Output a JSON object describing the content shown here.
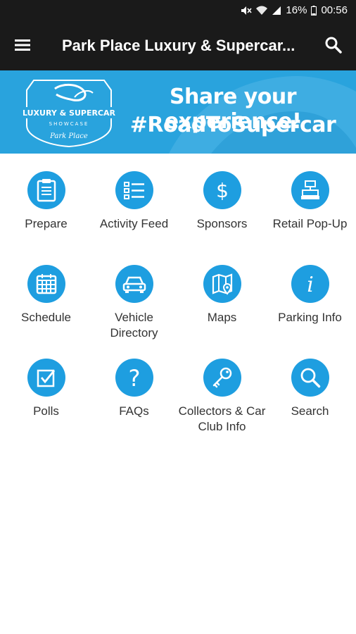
{
  "status_bar": {
    "battery": "16%",
    "time": "00:56"
  },
  "app_bar": {
    "title": "Park Place Luxury & Supercar..."
  },
  "banner": {
    "logo_text": [
      "LUXURY & SUPERCAR",
      "SHOWCASE",
      "Park Place"
    ],
    "line1": "Share your experience!",
    "line2": "#RoadToSupercar"
  },
  "tiles": [
    {
      "label": "Prepare",
      "icon": "clipboard-icon"
    },
    {
      "label": "Activity Feed",
      "icon": "list-icon"
    },
    {
      "label": "Sponsors",
      "icon": "dollar-icon"
    },
    {
      "label": "Retail Pop-Up",
      "icon": "register-icon"
    },
    {
      "label": "Schedule",
      "icon": "calendar-icon"
    },
    {
      "label": "Vehicle Directory",
      "icon": "car-icon"
    },
    {
      "label": "Maps",
      "icon": "map-icon"
    },
    {
      "label": "Parking Info",
      "icon": "info-icon"
    },
    {
      "label": "Polls",
      "icon": "checkbox-icon"
    },
    {
      "label": "FAQs",
      "icon": "question-icon"
    },
    {
      "label": "Collectors & Car Club Info",
      "icon": "key-icon"
    },
    {
      "label": "Search",
      "icon": "search-icon"
    }
  ],
  "colors": {
    "accent": "#1e9ee0",
    "banner": "#29a3dd",
    "bar": "#1a1a1a"
  }
}
